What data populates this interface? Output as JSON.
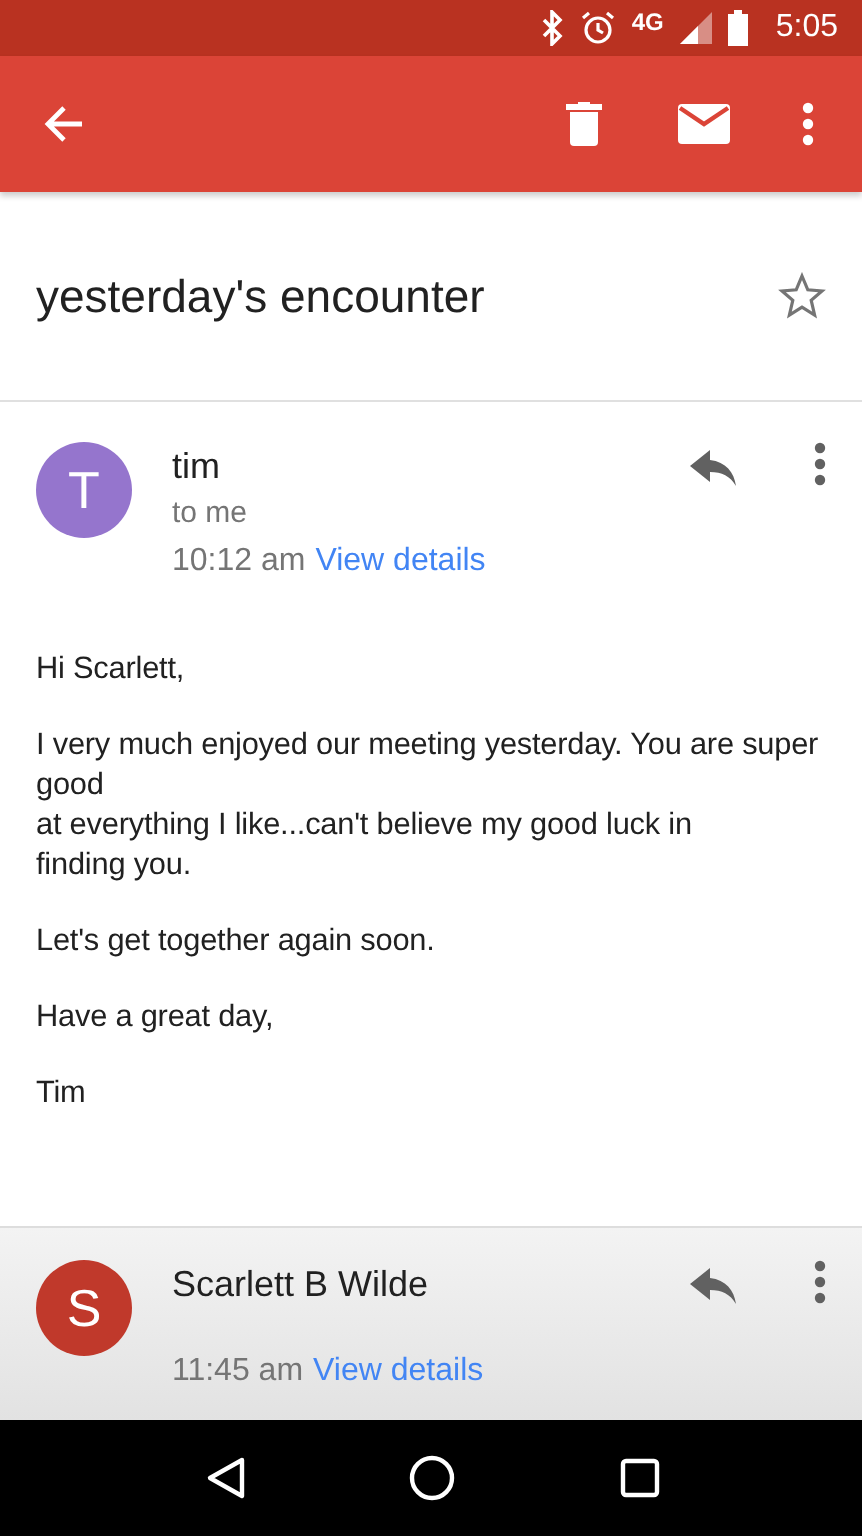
{
  "status_bar": {
    "network": "4G",
    "time": "5:05"
  },
  "subject": {
    "text": "yesterday's encounter",
    "starred": false
  },
  "messages": [
    {
      "avatar": "T",
      "color": "#9575cd",
      "sender": "tim",
      "recipient": "to me",
      "time": "10:12 am",
      "details_link": "View details",
      "expanded": true,
      "body": [
        "Hi Scarlett,",
        "I very much enjoyed our meeting yesterday. You are super good\nat everything I like...can't believe my good luck in\nfinding you.",
        "Let's get together again soon.",
        "Have a great day,",
        "Tim"
      ]
    },
    {
      "avatar": "S",
      "color": "#c0392b",
      "sender": "Scarlett B Wilde",
      "time": "11:45 am",
      "details_link": "View details",
      "expanded": false
    }
  ]
}
